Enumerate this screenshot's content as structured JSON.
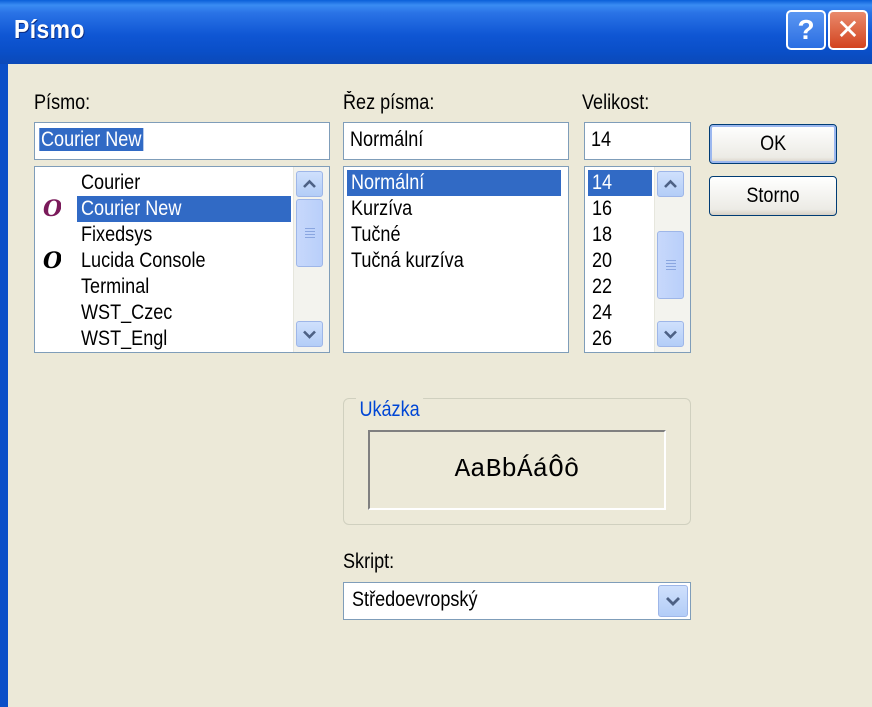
{
  "window": {
    "title": "Písmo",
    "help_button": "?",
    "close_button": "✕"
  },
  "font": {
    "label": "Písmo:",
    "value": "Courier New",
    "items": [
      {
        "label": "Courier",
        "icon": "",
        "selected": false
      },
      {
        "label": "Courier New",
        "icon": "opentype-font-icon",
        "selected": true
      },
      {
        "label": "Fixedsys",
        "icon": "",
        "selected": false
      },
      {
        "label": "Lucida Console",
        "icon": "opentype-font-icon",
        "selected": false
      },
      {
        "label": "Terminal",
        "icon": "",
        "selected": false
      },
      {
        "label": "WST_Czec",
        "icon": "",
        "selected": false
      },
      {
        "label": "WST_Engl",
        "icon": "",
        "selected": false
      }
    ]
  },
  "style": {
    "label": "Řez písma:",
    "value": "Normální",
    "items": [
      "Normální",
      "Kurzíva",
      "Tučné",
      "Tučná kurzíva"
    ],
    "selected_index": 0
  },
  "size": {
    "label": "Velikost:",
    "value": "14",
    "items": [
      "14",
      "16",
      "18",
      "20",
      "22",
      "24",
      "26"
    ],
    "selected_index": 0
  },
  "buttons": {
    "ok": "OK",
    "cancel": "Storno"
  },
  "sample": {
    "label": "Ukázka",
    "text": "AaBbÁáÔô"
  },
  "script": {
    "label": "Skript:",
    "value": "Středoevropský"
  },
  "colors": {
    "titlebar": "#0a4fc8",
    "selection": "#316ac5",
    "dialog_bg": "#ece9d8",
    "group_title": "#0046d5",
    "close_button": "#d3431f"
  }
}
